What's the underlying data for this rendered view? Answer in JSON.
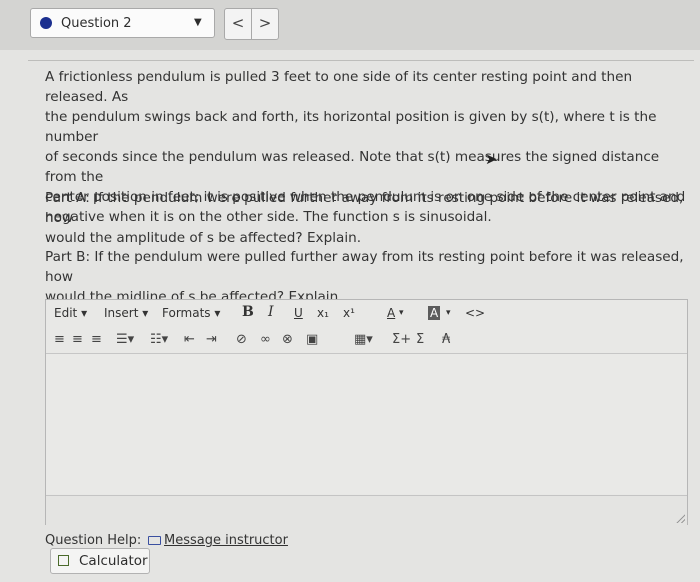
{
  "question_nav": {
    "label": "Question 2",
    "caret": "▼",
    "prev": "<",
    "next": ">"
  },
  "question": {
    "intro_lines": [
      "A frictionless pendulum is pulled 3 feet to one side of its center resting point and then released. As",
      "the pendulum swings back and forth, its horizontal position is given by s(t), where t is the number",
      "of seconds since the pendulum was released. Note that s(t) measures the signed distance from the",
      "center position in feet; it is positive when the pendulum is on one side of the center point and",
      "negative when it is on the other side. The function s is sinusoidal."
    ],
    "part_a_lines": [
      "Part A: If the pendulum were pulled further away from its resting point before it was released, how",
      "would the amplitude of s be affected? Explain."
    ],
    "part_b_lines": [
      "Part B: If the pendulum were pulled further away from its resting point before it was released, how",
      "would the midline of s be affected? Explain."
    ]
  },
  "editor": {
    "menu": {
      "edit": "Edit",
      "insert": "Insert",
      "formats": "Formats"
    },
    "format_buttons": {
      "bold": "B",
      "italic": "I",
      "underline": "U",
      "subscript": "x₁",
      "superscript": "x¹",
      "font_color": "A",
      "highlight": "A",
      "code": "<>"
    },
    "row2_icons": [
      "align-left-icon",
      "align-center-icon",
      "align-right-icon",
      "bullet-list-icon",
      "numbered-list-icon",
      "outdent-icon",
      "indent-icon",
      "link-icon",
      "unlink-icon",
      "image-icon",
      "table-icon",
      "sigma-plus-icon",
      "sigma-icon",
      "formula-icon"
    ],
    "content": ""
  },
  "help": {
    "label": "Question Help:",
    "message_link": "Message instructor",
    "calculator": "Calculator"
  }
}
